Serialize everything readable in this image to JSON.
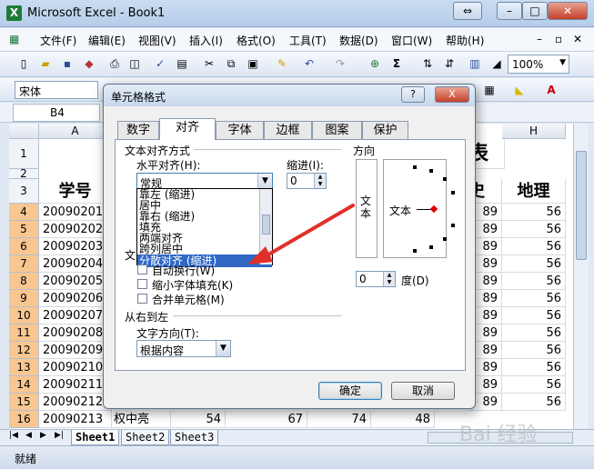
{
  "window": {
    "title": "Microsoft Excel - Book1",
    "app_icon": "excel-icon"
  },
  "menu": [
    "文件(F)",
    "编辑(E)",
    "视图(V)",
    "插入(I)",
    "格式(O)",
    "工具(T)",
    "数据(D)",
    "窗口(W)",
    "帮助(H)"
  ],
  "toolbar": {
    "zoom": "100%",
    "sum_symbol": "Σ"
  },
  "format": {
    "font": "宋体"
  },
  "namebox": {
    "ref": "B4"
  },
  "columns": [
    "A",
    "H"
  ],
  "rows": [
    "1",
    "2",
    "3",
    "4",
    "5",
    "6",
    "7",
    "8",
    "9",
    "10",
    "11",
    "12",
    "13",
    "14",
    "15",
    "16"
  ],
  "sheet": {
    "title_fragment": "表",
    "header_a": "学号",
    "header_g_frag": "史",
    "header_h": "地理",
    "ids": [
      "20090201",
      "20090202",
      "20090203",
      "20090204",
      "20090205",
      "20090206",
      "20090207",
      "20090208",
      "20090209",
      "20090210",
      "20090211",
      "20090212",
      "20090213"
    ],
    "col_g": [
      "89",
      "89",
      "89",
      "89",
      "89",
      "89",
      "89",
      "89",
      "89",
      "89",
      "89",
      "89"
    ],
    "col_h": [
      "56",
      "56",
      "56",
      "56",
      "56",
      "56",
      "56",
      "56",
      "56",
      "56",
      "56",
      "56"
    ],
    "last_row": {
      "b": "权中亮",
      "c": "54",
      "d": "67",
      "e": "74",
      "f": "48"
    }
  },
  "sheet_tabs": [
    "Sheet1",
    "Sheet2",
    "Sheet3"
  ],
  "status": "就绪",
  "dialog": {
    "title": "单元格格式",
    "help_btn": "?",
    "close_btn": "X",
    "tabs": [
      "数字",
      "对齐",
      "字体",
      "边框",
      "图案",
      "保护"
    ],
    "section_align": "文本对齐方式",
    "h_align_label": "水平对齐(H):",
    "h_align_value": "常规",
    "indent_label": "缩进(I):",
    "indent_value": "0",
    "options": [
      "靠左 (缩进)",
      "居中",
      "靠右 (缩进)",
      "填充",
      "两端对齐",
      "跨列居中",
      "分散对齐 (缩进)"
    ],
    "section_text_control_frag": "文",
    "check_wrap": "自动换行(W)",
    "check_shrink": "缩小字体填充(K)",
    "check_merge": "合并单元格(M)",
    "section_rtl": "从右到左",
    "text_dir_label": "文字方向(T):",
    "text_dir_value": "根据内容",
    "orientation_label": "方向",
    "orient_vertical_text": "文本",
    "orient_text": "文本",
    "degree_value": "0",
    "degree_label": "度(D)",
    "ok": "确定",
    "cancel": "取消"
  },
  "watermark": "Bai 经验"
}
